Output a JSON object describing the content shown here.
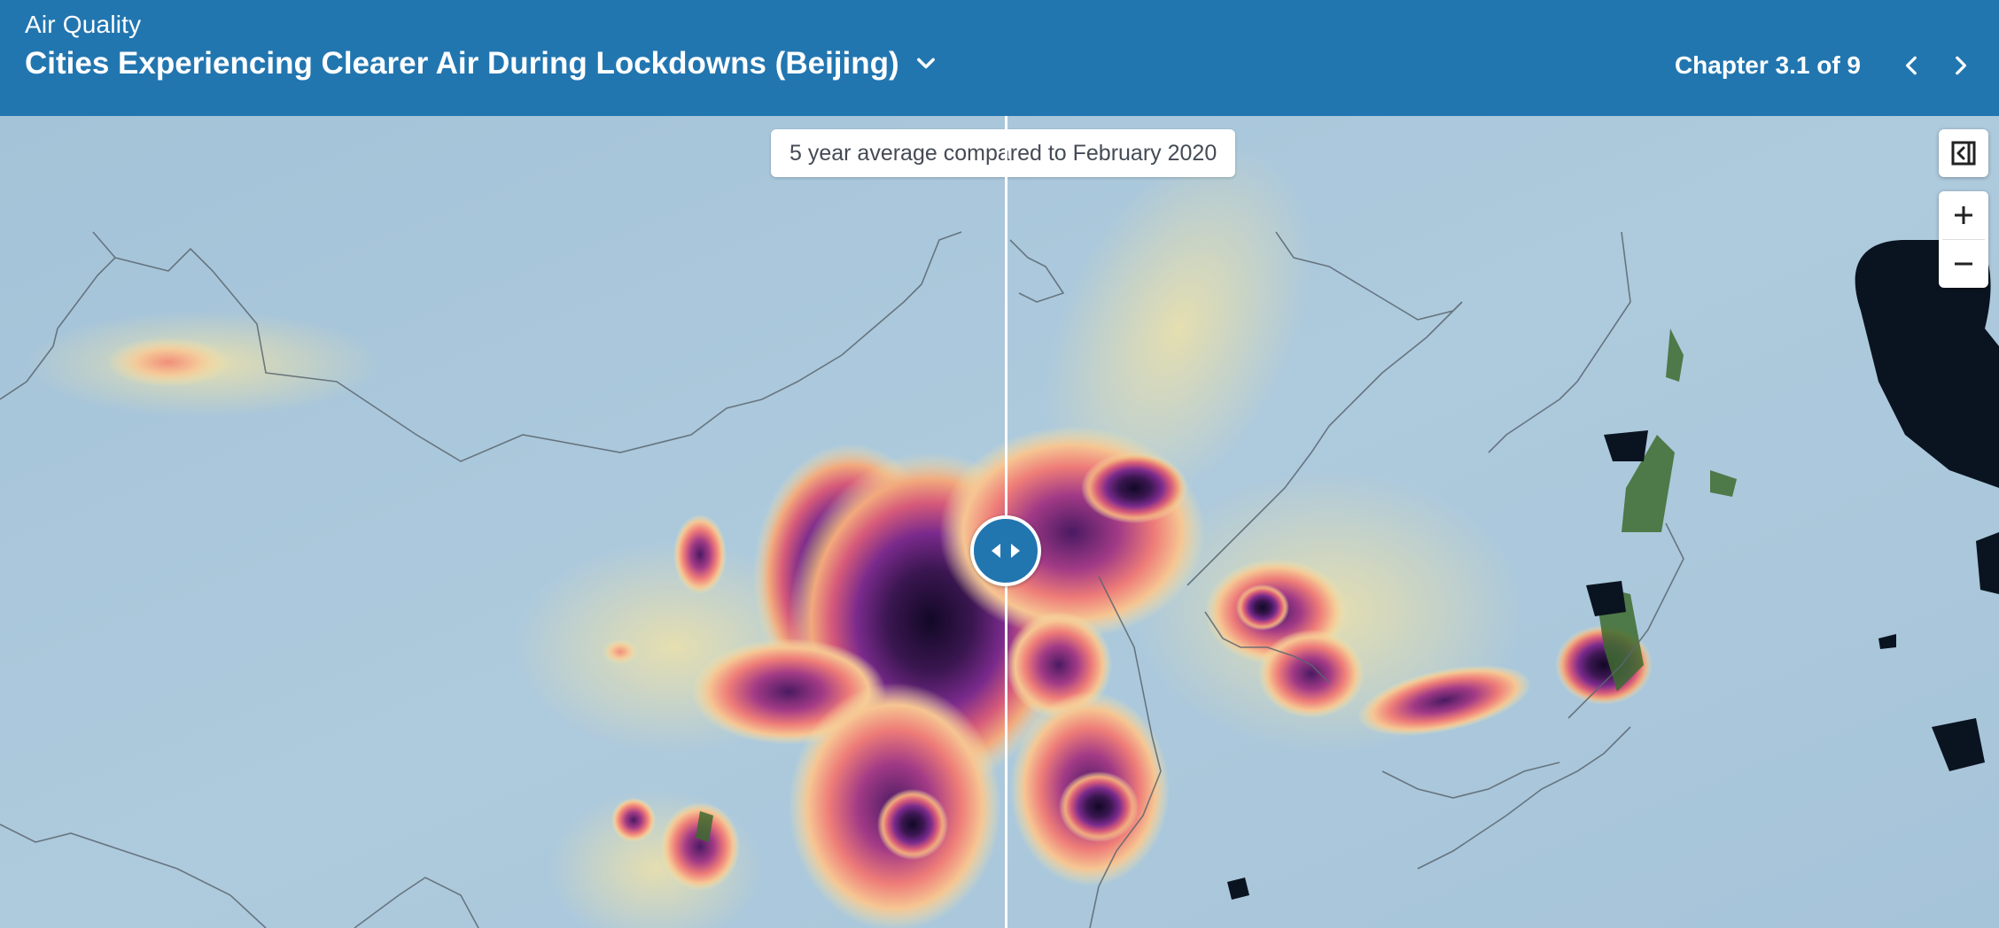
{
  "header": {
    "app_name": "Air Quality",
    "story_title": "Cities Experiencing Clearer Air During Lockdowns (Beijing)",
    "chapter_label": "Chapter 3.1 of 9"
  },
  "map": {
    "compare_label": "5 year average compared to February 2020",
    "controls": {
      "toggle_panel_icon": "collapse-panel-icon",
      "zoom_in_icon": "plus-icon",
      "zoom_out_icon": "minus-icon"
    },
    "divider_icon": "left-right-arrows-icon"
  },
  "colors": {
    "header_bg": "#2276b0",
    "map_base": "#a9c6dc",
    "pollution_low": "#f5e6a8",
    "pollution_mid": "#ef8a6e",
    "pollution_high": "#7a2a8c",
    "pollution_max": "#120826",
    "land_vegetation": "#3d6b2e"
  }
}
